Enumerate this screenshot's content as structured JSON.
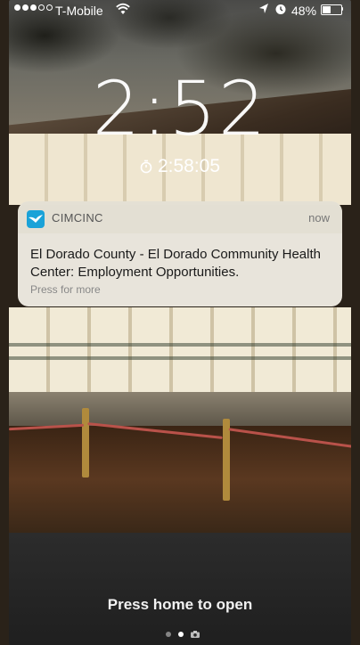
{
  "status_bar": {
    "carrier": "T-Mobile",
    "battery_percent": "48%",
    "signal_bars_filled": 3,
    "signal_bars_total": 5,
    "icons": [
      "wifi-icon",
      "location-icon",
      "alarm-icon",
      "battery-icon"
    ]
  },
  "lock_screen": {
    "time": "2:52",
    "timer": "2:58:05",
    "timer_icon": "timer-icon"
  },
  "notification": {
    "app_name": "CIMCINC",
    "app_icon": "bird-icon",
    "time": "now",
    "body": "El Dorado County - El Dorado Community Health Center: Employment Opportunities.",
    "action_hint": "Press for more"
  },
  "bottom": {
    "unlock_hint": "Press home to open",
    "pages": 2,
    "active_page": 2,
    "camera_icon": "camera-icon"
  },
  "colors": {
    "app_icon_bg": "#1aa2d8",
    "notification_bg": "#f6f3eb"
  }
}
